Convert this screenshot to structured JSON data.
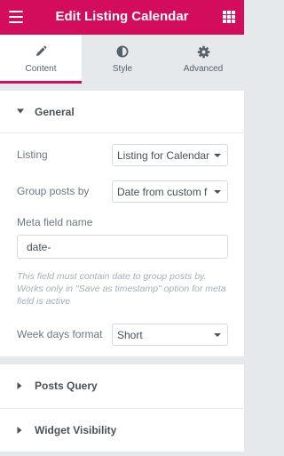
{
  "header": {
    "title": "Edit Listing Calendar",
    "menu_icon": "hamburger-menu-icon",
    "apps_icon": "apps-grid-icon",
    "color": "#d30c5c"
  },
  "tabs": [
    {
      "label": "Content",
      "icon": "pencil-icon",
      "active": true
    },
    {
      "label": "Style",
      "icon": "half-circle-icon",
      "active": false
    },
    {
      "label": "Advanced",
      "icon": "gear-icon",
      "active": false
    }
  ],
  "general": {
    "title": "General",
    "expanded": true,
    "listing": {
      "label": "Listing",
      "value": "Listing for Calendar"
    },
    "group_posts": {
      "label": "Group posts by",
      "value": "Date from custom f"
    },
    "meta_field": {
      "label": "Meta field name",
      "value": "date-"
    },
    "description": "This field must contain date to group posts by. Works only in \"Save as timestamp\" option for meta field is active",
    "week_days": {
      "label": "Week days format",
      "value": "Short"
    }
  },
  "posts_query": {
    "title": "Posts Query",
    "expanded": false
  },
  "widget_visibility": {
    "title": "Widget Visibility",
    "expanded": false
  }
}
